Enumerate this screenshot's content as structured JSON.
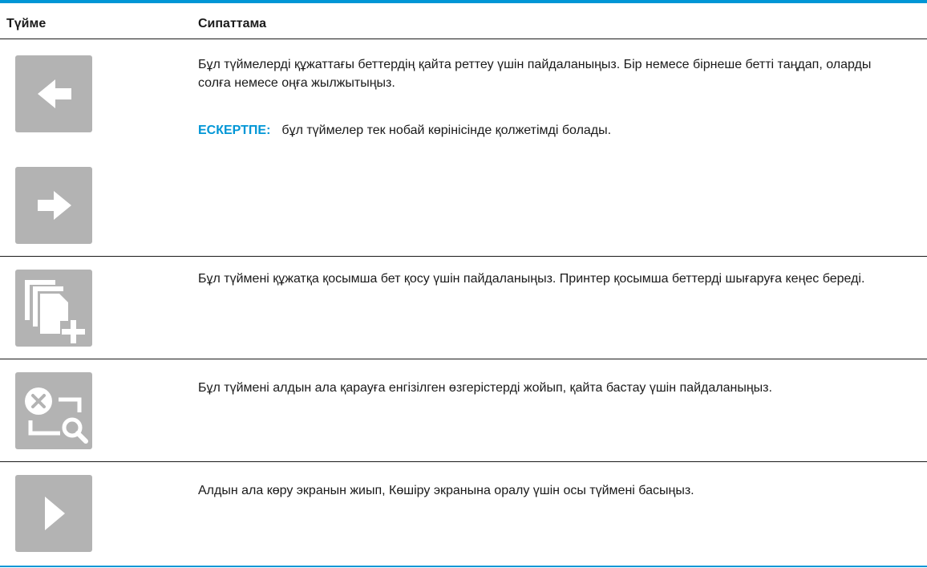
{
  "table": {
    "headers": {
      "button": "Түйме",
      "description": "Сипаттама"
    },
    "rows": [
      {
        "icons": [
          "arrow-left-icon",
          "arrow-right-icon"
        ],
        "description": "Бұл түймелерді құжаттағы беттердің қайта реттеу үшін пайдаланыңыз. Бір немесе бірнеше бетті таңдап, оларды солға немесе оңға жылжытыңыз.",
        "note_label": "ЕСКЕРТПЕ:",
        "note_text": "бұл түймелер тек нобай көрінісінде қолжетімді болады."
      },
      {
        "icons": [
          "add-page-icon"
        ],
        "description": "Бұл түймені құжатқа қосымша бет қосу үшін пайдаланыңыз. Принтер қосымша беттерді шығаруға кеңес береді."
      },
      {
        "icons": [
          "reset-preview-icon"
        ],
        "description": "Бұл түймені алдын ала қарауға енгізілген өзгерістерді жойып, қайта бастау үшін пайдаланыңыз."
      },
      {
        "icons": [
          "play-icon"
        ],
        "description": "Алдын ала көру экранын жиып, Көшіру экранына оралу үшін осы түймені басыңыз."
      }
    ]
  },
  "colors": {
    "accent": "#0096d6",
    "button_bg": "#b3b3b3",
    "icon": "#ffffff"
  }
}
